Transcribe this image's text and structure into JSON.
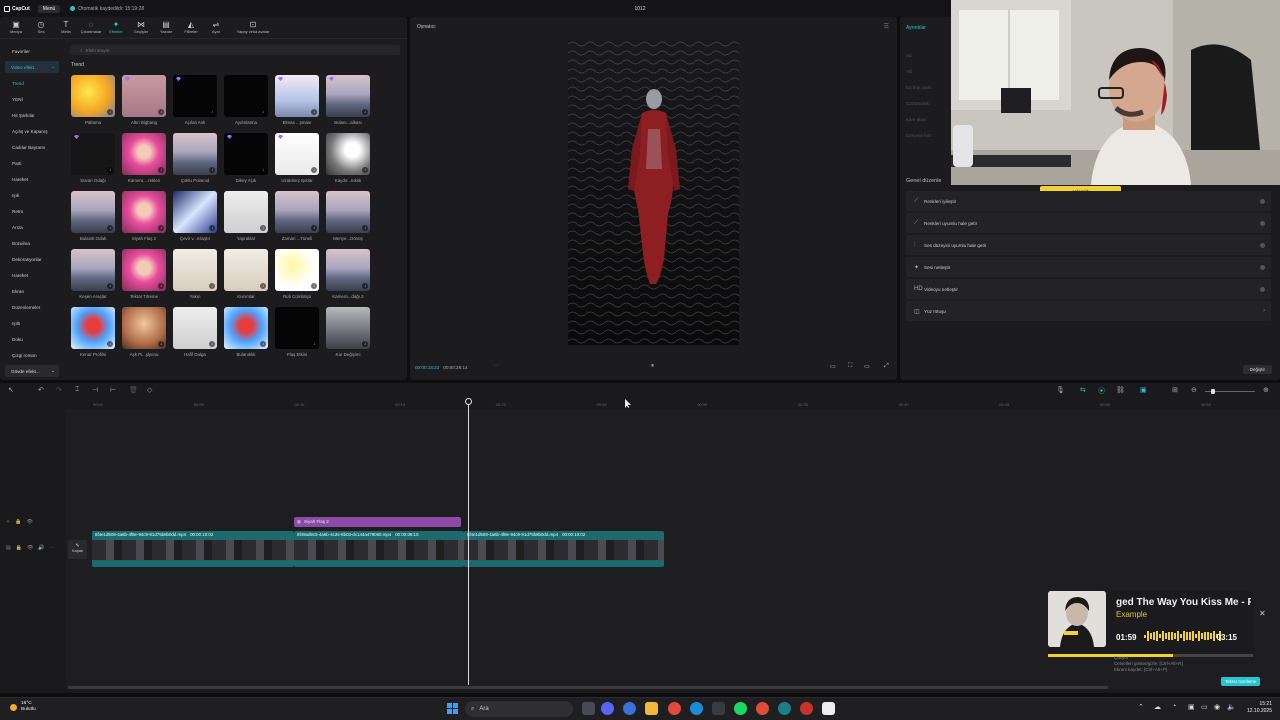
{
  "titlebar": {
    "app_name": "CapCut",
    "menu_label": "Menü",
    "autosave": "Otomatik kaydedildi: 15:19:28",
    "project_title": "1012"
  },
  "toolbar": {
    "items": [
      {
        "label": "Medya",
        "icon": "media-icon"
      },
      {
        "label": "Ses",
        "icon": "audio-icon"
      },
      {
        "label": "Metin",
        "icon": "text-icon"
      },
      {
        "label": "Çıkartmalar",
        "icon": "sticker-icon"
      },
      {
        "label": "Efektler",
        "icon": "effects-icon",
        "active": true
      },
      {
        "label": "Geçişler",
        "icon": "transitions-icon"
      },
      {
        "label": "Yazılar",
        "icon": "captions-icon"
      },
      {
        "label": "Filtreler",
        "icon": "filters-icon"
      },
      {
        "label": "Ayar",
        "icon": "adjust-icon"
      },
      {
        "label": "Yapay zekâ avatar",
        "icon": "ai-avatar-icon"
      }
    ]
  },
  "sidebar": {
    "favorites": "Favoriler",
    "video_effects_group": "Video efekt...",
    "items": [
      "Trend",
      "YENİ",
      "Hit Şarkılar",
      "Açılış ve Kapanış",
      "Cadılar Bayramı",
      "Parti",
      "Hareket",
      "Işık",
      "Retro",
      "Arıza",
      "Bozulma",
      "Dekorasyonlar",
      "Hareket",
      "Ekran",
      "Düzenlemeler",
      "Işıltı",
      "Doku",
      "Çizgi roman"
    ],
    "body_effects_group": "Gövde efekt..."
  },
  "search": {
    "placeholder": "Efekt arayın"
  },
  "effects": {
    "section_title": "Trend",
    "items": [
      {
        "label": "Patlama",
        "style": "yellow",
        "gem": false,
        "dl": true
      },
      {
        "label": "Altın Bigbang",
        "style": "pink-blur",
        "gem": true,
        "dl": true
      },
      {
        "label": "Açılan Ask",
        "style": "black",
        "gem": true,
        "dl": true
      },
      {
        "label": "Aydınlatma",
        "style": "black",
        "gem": false,
        "dl": true
      },
      {
        "label": "Elmas ...şması",
        "style": "city-glow",
        "gem": true,
        "dl": true
      },
      {
        "label": "Bulanı...alkası",
        "style": "city",
        "gem": true,
        "dl": true
      },
      {
        "label": "Süvari Odağı",
        "style": "dark",
        "gem": true,
        "dl": true
      },
      {
        "label": "Kamera ...rekleri",
        "style": "pink",
        "gem": false,
        "dl": true
      },
      {
        "label": "Çoklu Polaroid",
        "style": "city",
        "gem": false,
        "dl": true
      },
      {
        "label": "Dikey Açık",
        "style": "black",
        "gem": true,
        "dl": true
      },
      {
        "label": "Uzatılmış Işıklar",
        "style": "white",
        "gem": true,
        "dl": true
      },
      {
        "label": "Kaydır...nıklık",
        "style": "gray",
        "gem": false,
        "dl": true
      },
      {
        "label": "Bulanık Odak",
        "style": "city",
        "gem": false,
        "dl": true
      },
      {
        "label": "Siyah Flaş 2",
        "style": "pink",
        "gem": false,
        "dl": true
      },
      {
        "label": "Çevir v...nılaştır",
        "style": "blue-blur",
        "gem": false,
        "dl": true
      },
      {
        "label": "Yapraklar",
        "style": "dancer",
        "gem": false,
        "dl": true
      },
      {
        "label": "Zaman ...Tüneli",
        "style": "city",
        "gem": false,
        "dl": true
      },
      {
        "label": "Menye...Dönüş",
        "style": "city",
        "gem": false,
        "dl": true
      },
      {
        "label": "Keşen Araçlar",
        "style": "city",
        "gem": false,
        "dl": true
      },
      {
        "label": "Tekrar Titreme",
        "style": "pink",
        "gem": false,
        "dl": true
      },
      {
        "label": "Yakın",
        "style": "portrait",
        "gem": false,
        "dl": true
      },
      {
        "label": "Kıvrımlar",
        "style": "portrait",
        "gem": false,
        "dl": true
      },
      {
        "label": "Ruh Cümbüşü",
        "style": "yellow-white",
        "gem": false,
        "dl": true
      },
      {
        "label": "Kamera...dağı 2",
        "style": "city",
        "gem": false,
        "dl": true
      },
      {
        "label": "Kenar Profilsi",
        "style": "red-blue",
        "gem": false,
        "dl": true
      },
      {
        "label": "Aşk Pi...şlyonu",
        "style": "portrait-warm",
        "gem": false,
        "dl": true
      },
      {
        "label": "Hafif Dalga",
        "style": "dancer",
        "gem": false,
        "dl": true
      },
      {
        "label": "Bulanıklık",
        "style": "red-blue",
        "gem": false,
        "dl": true
      },
      {
        "label": "Flaş Etkisi",
        "style": "black",
        "gem": false,
        "dl": true
      },
      {
        "label": "Kar Değişimi",
        "style": "mountain",
        "gem": false,
        "dl": true
      }
    ]
  },
  "player": {
    "title": "Oynatıcı",
    "current_time": "00:00:18:23",
    "total_time": "00:00:28:14"
  },
  "details": {
    "title": "Ayrıntılar",
    "fields": [
      "Ad:",
      "Yol:",
      "En boy oranı:",
      "Çözünürlük:",
      "Kare alanı:",
      "Çerçeve hızı:"
    ],
    "general_header": "Genel düzenle",
    "got_it": "Anlaşıldı",
    "features": [
      {
        "label": "Renkleri iyileştir",
        "icon": "magic-icon",
        "kind": "toggle"
      },
      {
        "label": "Renkleri uyumlu hale getir",
        "icon": "palette-icon",
        "kind": "toggle"
      },
      {
        "label": "Ses düzeyini uyumlu hale getir",
        "icon": "sliders-icon",
        "kind": "toggle"
      },
      {
        "label": "Sesi netleştir",
        "icon": "sparkle-icon",
        "kind": "toggle"
      },
      {
        "label": "Videoyu netleştir",
        "icon": "hd-icon",
        "kind": "toggle"
      },
      {
        "label": "Yüz rötuşu",
        "icon": "face-icon",
        "kind": "arrow"
      }
    ],
    "change_button": "Değiştir"
  },
  "timeline": {
    "ruler": [
      "00:00",
      "00:05",
      "00:10",
      "00:15",
      "00:20",
      "00:25",
      "00:30",
      "00:35",
      "00:40",
      "00:45",
      "00:50",
      "00:55"
    ],
    "cover_label": "Kapak",
    "effect_clip": "Siyah Flaş 2",
    "clips": [
      {
        "name": "8f4e1d508-4a6b-4f8e-94c9-91d75b8b0dd.mp4",
        "duration": "00:00:10:02"
      },
      {
        "name": "8f49ad9c5-4a6b-4c26-8b03-dc144a478060.mp4",
        "duration": "00:00:08:10"
      },
      {
        "name": "8f4e1d508-4a6b-4f8e-94c9-91d75b8b0dd.mp4",
        "duration": "00:00:10:02"
      }
    ]
  },
  "now_playing": {
    "song": "ged The Way You Kiss Me - R",
    "artist": "Example",
    "elapsed": "01:59",
    "duration": "03:15",
    "progress": 0.61,
    "notification_line1": "Çalıyor",
    "notification_line2": "Cetvelleri göster/gizle: [Ctrl+Alt+R]",
    "notification_line3": "Ekranı kaydet: [Ctrl+Alt+P]",
    "notification_button": "Tekrar özetleme"
  },
  "taskbar": {
    "temperature": "16°C",
    "weather": "Bulutlu",
    "search_placeholder": "Ara",
    "time": "15:21",
    "date": "12.10.2025"
  },
  "colors": {
    "accent": "#28c4cf",
    "clip": "#1d6a6e",
    "effect": "#8a4aa5",
    "highlight": "#f2d233"
  }
}
